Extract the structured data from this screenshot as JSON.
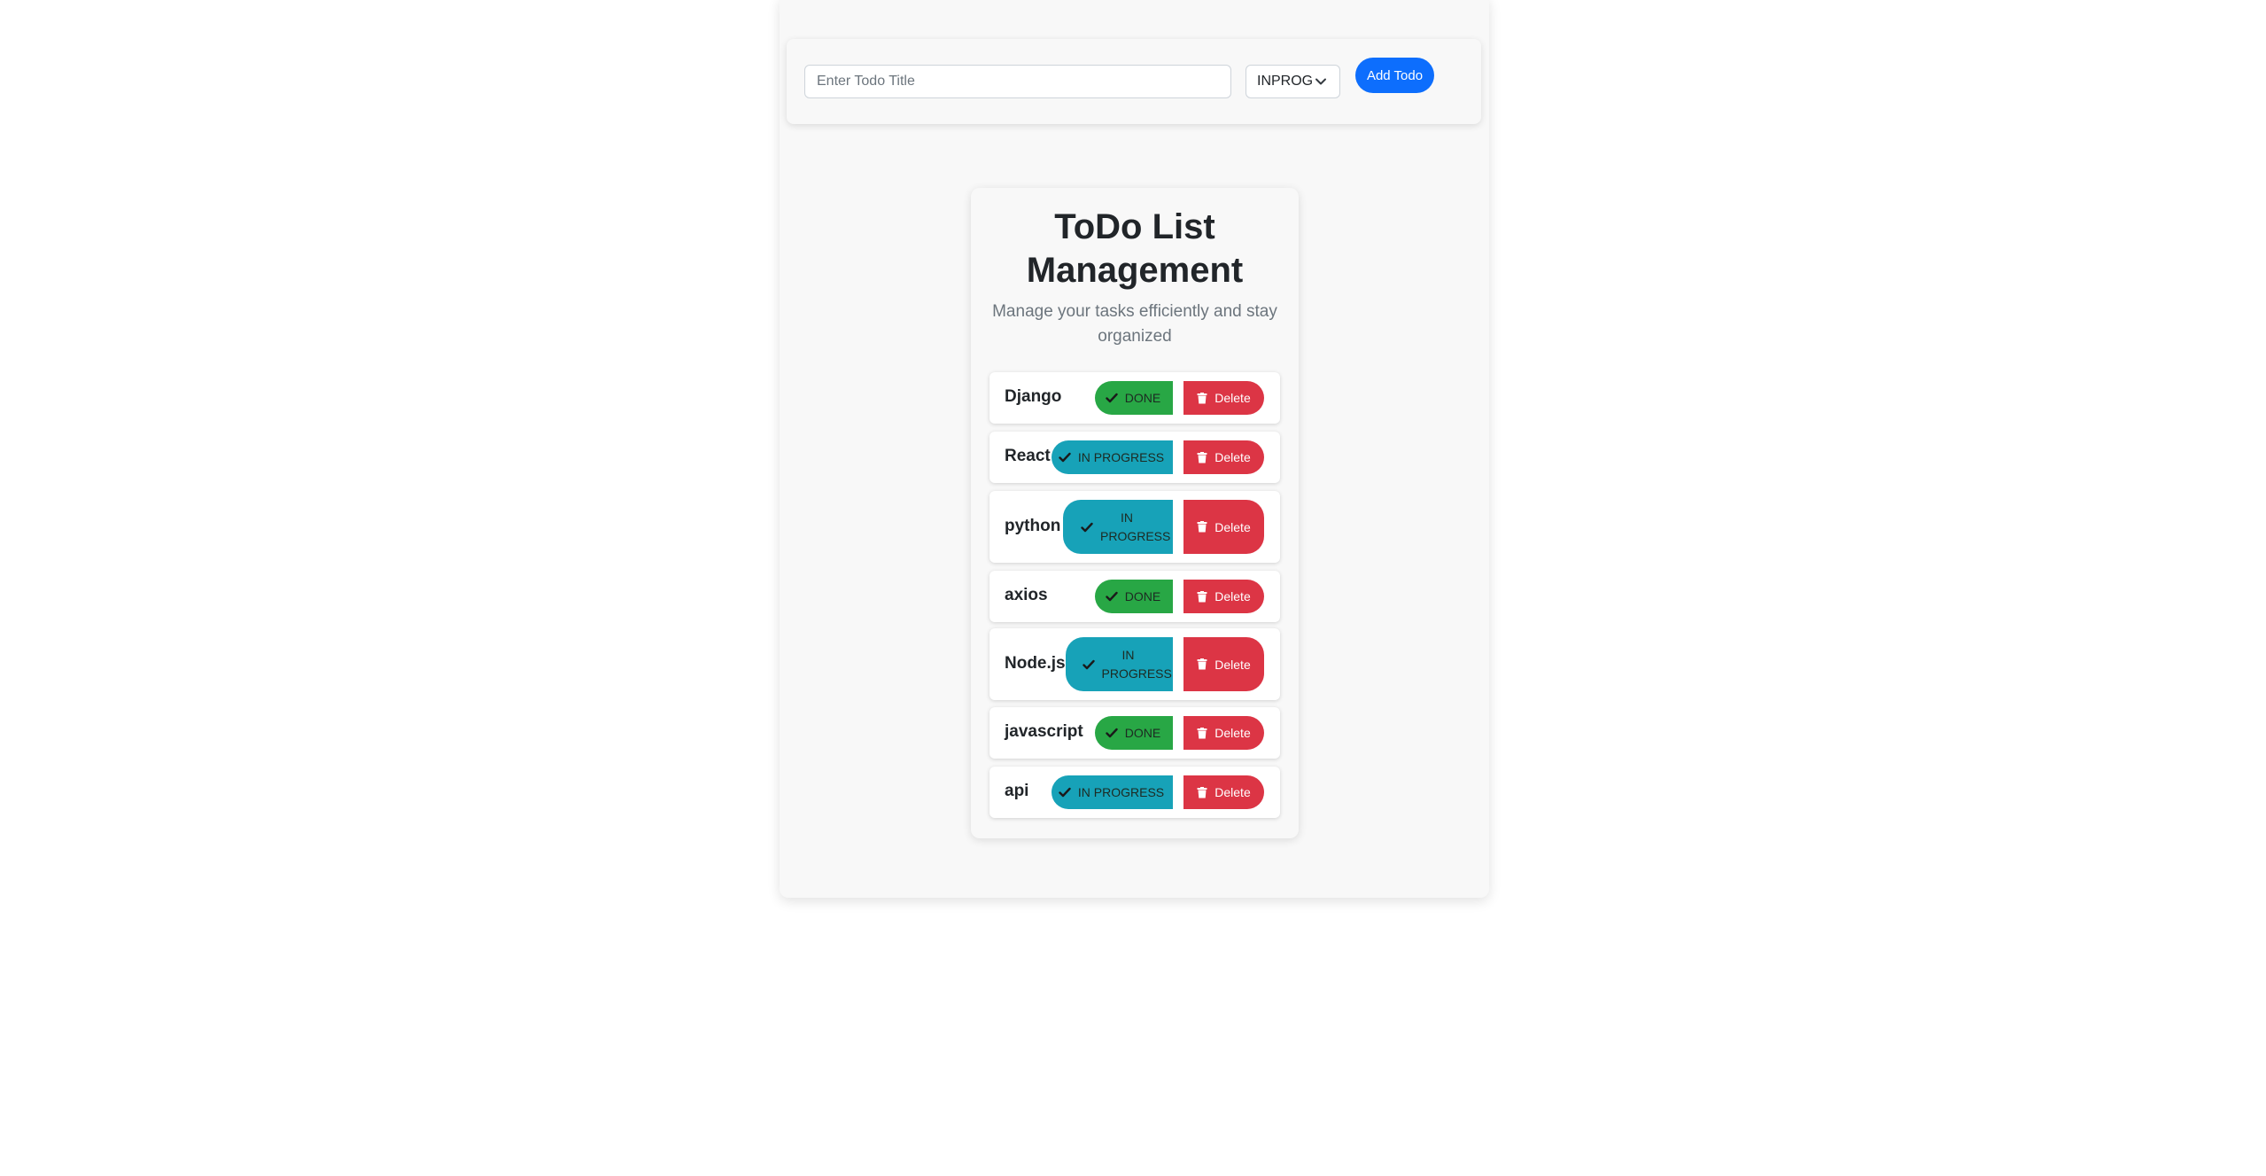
{
  "form": {
    "title_placeholder": "Enter Todo Title",
    "title_value": "",
    "status_selected": "INPROG",
    "add_label": "Add Todo"
  },
  "header": {
    "title": "ToDo List Management",
    "subtitle": "Manage your tasks efficiently and stay organized"
  },
  "delete_label": "Delete",
  "colors": {
    "done": "#28a745",
    "in_progress": "#17a2b8",
    "delete": "#dc3545",
    "primary": "#0d6efd"
  },
  "todos": [
    {
      "title": "Django",
      "status": "DONE"
    },
    {
      "title": "React",
      "status": "IN PROGRESS"
    },
    {
      "title": "python",
      "status": "IN PROGRESS"
    },
    {
      "title": "axios",
      "status": "DONE"
    },
    {
      "title": "Node.js",
      "status": "IN PROGRESS"
    },
    {
      "title": "javascript",
      "status": "DONE"
    },
    {
      "title": "api",
      "status": "IN PROGRESS"
    }
  ]
}
